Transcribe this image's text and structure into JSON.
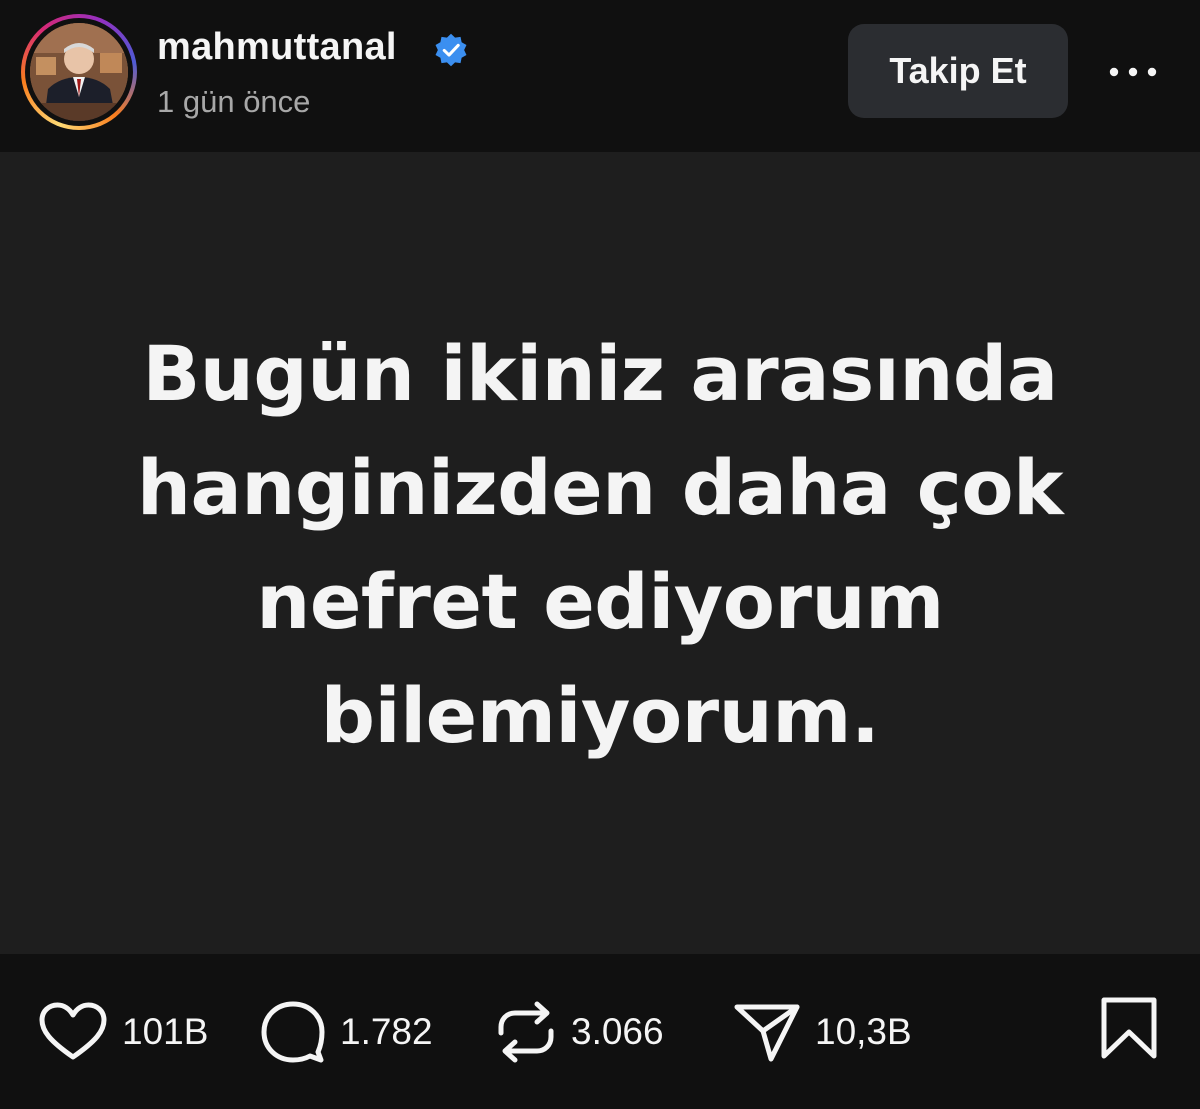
{
  "header": {
    "username": "mahmuttanal",
    "timestamp": "1 gün önce",
    "follow_label": "Takip Et"
  },
  "post": {
    "lines": [
      "Bugün ikiniz arasında",
      "hanginizden daha çok",
      "nefret ediyorum",
      "bilemiyorum."
    ]
  },
  "actions": {
    "likes": "101B",
    "comments": "1.782",
    "reposts": "3.066",
    "shares": "10,3B"
  },
  "colors": {
    "background": "#101010",
    "post_background": "#1e1e1e",
    "button_background": "#2b2d31",
    "verified_blue": "#3b8ff0",
    "secondary_text": "#a8a8a8"
  },
  "icons": [
    "verified-badge-icon",
    "more-options-icon",
    "heart-icon",
    "comment-icon",
    "repost-icon",
    "share-icon",
    "bookmark-icon"
  ]
}
